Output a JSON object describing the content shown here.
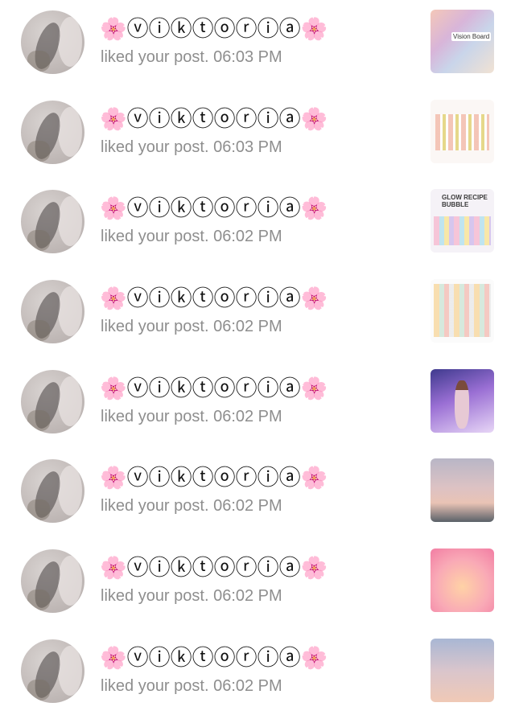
{
  "notifications": [
    {
      "username": "🌸ⓥⓘⓚⓣⓞⓡⓘⓐ🌸",
      "action": "liked your post.",
      "time": "06:03 PM",
      "thumb_text": "Vision Board"
    },
    {
      "username": "🌸ⓥⓘⓚⓣⓞⓡⓘⓐ🌸",
      "action": "liked your post.",
      "time": "06:03 PM",
      "thumb_text": ""
    },
    {
      "username": "🌸ⓥⓘⓚⓣⓞⓡⓘⓐ🌸",
      "action": "liked your post.",
      "time": "06:02 PM",
      "thumb_text": "GLOW RECIPE BUBBLE"
    },
    {
      "username": "🌸ⓥⓘⓚⓣⓞⓡⓘⓐ🌸",
      "action": "liked your post.",
      "time": "06:02 PM",
      "thumb_text": ""
    },
    {
      "username": "🌸ⓥⓘⓚⓣⓞⓡⓘⓐ🌸",
      "action": "liked your post.",
      "time": "06:02 PM",
      "thumb_text": ""
    },
    {
      "username": "🌸ⓥⓘⓚⓣⓞⓡⓘⓐ🌸",
      "action": "liked your post.",
      "time": "06:02 PM",
      "thumb_text": ""
    },
    {
      "username": "🌸ⓥⓘⓚⓣⓞⓡⓘⓐ🌸",
      "action": "liked your post.",
      "time": "06:02 PM",
      "thumb_text": ""
    },
    {
      "username": "🌸ⓥⓘⓚⓣⓞⓡⓘⓐ🌸",
      "action": "liked your post.",
      "time": "06:02 PM",
      "thumb_text": ""
    }
  ],
  "colors": {
    "background": "#ffffff",
    "name_text": "#111111",
    "meta_text": "#8e8e8e"
  }
}
